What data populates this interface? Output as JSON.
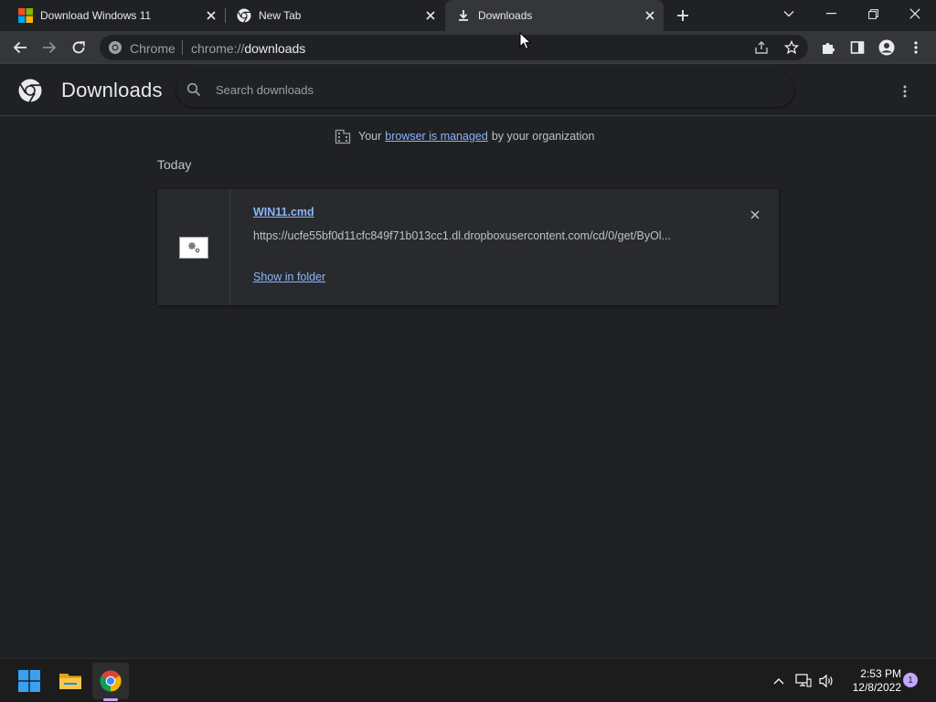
{
  "tabs": [
    {
      "title": "Download Windows 11",
      "favicon": "windows-logo-icon"
    },
    {
      "title": "New Tab",
      "favicon": "chrome-logo-icon"
    },
    {
      "title": "Downloads",
      "favicon": "download-icon",
      "active": true
    }
  ],
  "omnibox": {
    "chip": "Chrome",
    "scheme": "chrome://",
    "host": "downloads"
  },
  "page": {
    "title": "Downloads",
    "search_placeholder": "Search downloads"
  },
  "managed_banner": {
    "prefix": "Your",
    "link": "browser is managed",
    "suffix": "by your organization"
  },
  "downloads": {
    "section_label": "Today",
    "items": [
      {
        "file_name": "WIN11.cmd",
        "url": "https://ucfe55bf0d11cfc849f71b013cc1.dl.dropboxusercontent.com/cd/0/get/ByOl...",
        "action": "Show in folder"
      }
    ]
  },
  "taskbar": {
    "time": "2:53 PM",
    "date": "12/8/2022",
    "notifications": "1"
  },
  "colors": {
    "background": "#202124",
    "toolbar": "#35363a",
    "link": "#8ab4f8",
    "text_secondary": "#bdc1c6"
  }
}
